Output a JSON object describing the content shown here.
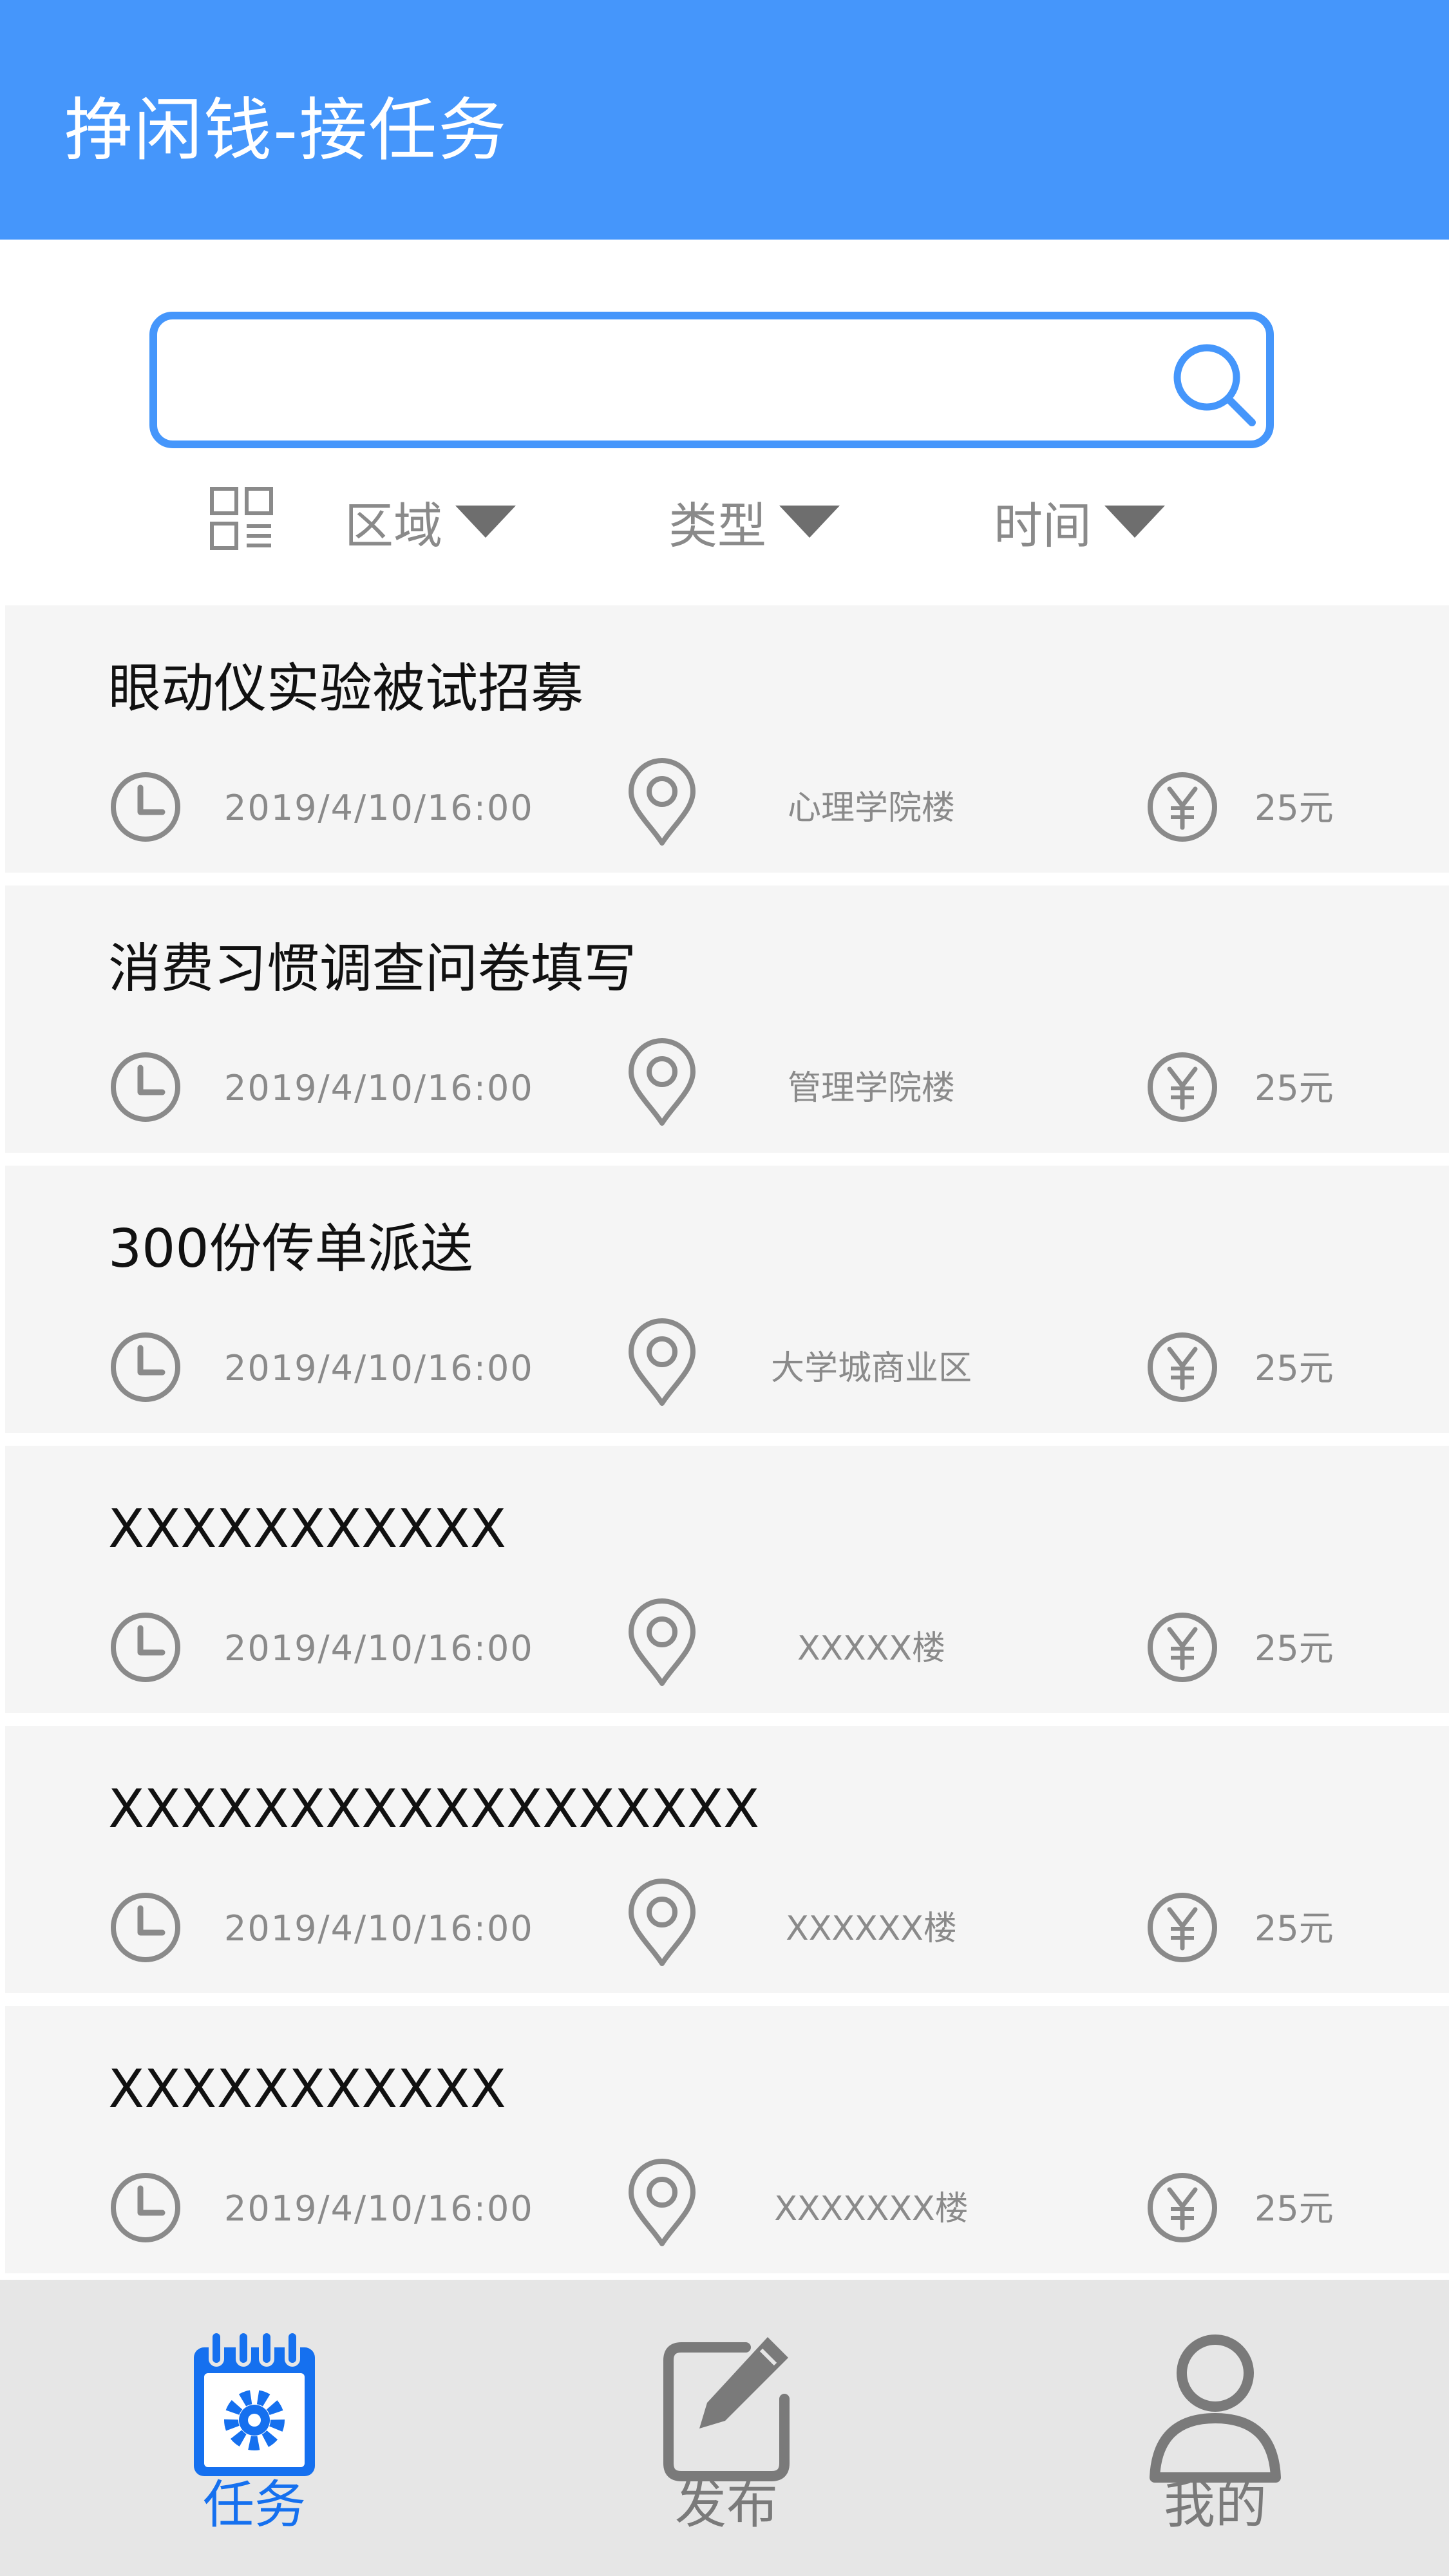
{
  "header": {
    "title": "挣闲钱-接任务"
  },
  "search": {
    "value": "",
    "placeholder": ""
  },
  "filters": [
    {
      "label": "区域"
    },
    {
      "label": "类型"
    },
    {
      "label": "时间"
    }
  ],
  "tasks": [
    {
      "title": "眼动仪实验被试招募",
      "time": "2019/4/10/16:00",
      "place": "心理学院楼",
      "price": "25元"
    },
    {
      "title": "消费习惯调查问卷填写",
      "time": "2019/4/10/16:00",
      "place": "管理学院楼",
      "price": "25元"
    },
    {
      "title": "300份传单派送",
      "time": "2019/4/10/16:00",
      "place": "大学城商业区",
      "price": "25元"
    },
    {
      "title": "XXXXXXXXXXX",
      "time": "2019/4/10/16:00",
      "place": "XXXXX楼",
      "price": "25元"
    },
    {
      "title": "XXXXXXXXXXXXXXXXXX",
      "time": "2019/4/10/16:00",
      "place": "XXXXXX楼",
      "price": "25元"
    },
    {
      "title": "XXXXXXXXXXX",
      "time": "2019/4/10/16:00",
      "place": "XXXXXXX楼",
      "price": "25元"
    }
  ],
  "tabbar": {
    "tabs": [
      {
        "label": "任务",
        "icon": "calendar-gear-icon",
        "active": true
      },
      {
        "label": "发布",
        "icon": "edit-icon",
        "active": false
      },
      {
        "label": "我的",
        "icon": "user-icon",
        "active": false
      }
    ]
  },
  "colors": {
    "accent": "#4596fb",
    "tab_active": "#1570ef",
    "tab_inactive": "#7a7a7a",
    "card_background": "#f5f5f5",
    "icon_gray": "#8a8a8a"
  }
}
